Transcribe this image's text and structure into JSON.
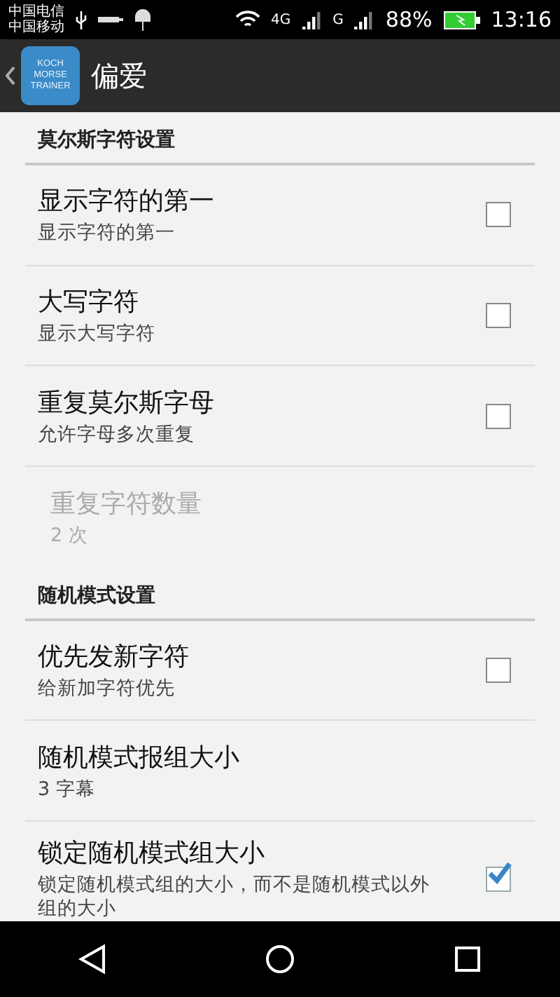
{
  "status_bar": {
    "carriers": [
      "中国电信",
      "中国移动"
    ],
    "network_labels": [
      "4G",
      "G"
    ],
    "battery": "88%",
    "time": "13:16"
  },
  "app_bar": {
    "logo_text": [
      "KOCH",
      "MORSE",
      "TRAINER"
    ],
    "title": "偏爱"
  },
  "sections": [
    {
      "title": "莫尔斯字符设置",
      "items": [
        {
          "kind": "checkbox",
          "title": "显示字符的第一",
          "summary": "显示字符的第一",
          "checked": false,
          "disabled": false
        },
        {
          "kind": "checkbox",
          "title": "大写字符",
          "summary": "显示大写字符",
          "checked": false,
          "disabled": false
        },
        {
          "kind": "checkbox",
          "title": "重复莫尔斯字母",
          "summary": "允许字母多次重复",
          "checked": false,
          "disabled": false
        },
        {
          "kind": "value",
          "title": "重复字符数量",
          "summary": "2 次",
          "disabled": true
        }
      ]
    },
    {
      "title": "随机模式设置",
      "items": [
        {
          "kind": "checkbox",
          "title": "优先发新字符",
          "summary": "给新加字符优先",
          "checked": false,
          "disabled": false
        },
        {
          "kind": "value",
          "title": "随机模式报组大小",
          "summary": "3 字幕",
          "disabled": false
        },
        {
          "kind": "checkbox",
          "title": "锁定随机模式组大小",
          "summary": "锁定随机模式组的大小，而不是随机模式以外组的大小",
          "checked": true,
          "disabled": false
        }
      ]
    }
  ]
}
